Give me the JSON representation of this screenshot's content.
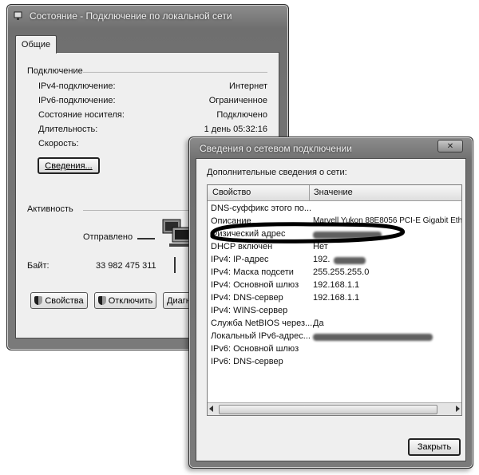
{
  "status_window": {
    "title": "Состояние - Подключение по локальной сети",
    "tab": "Общие",
    "connection_section": "Подключение",
    "rows": [
      {
        "label": "IPv4-подключение:",
        "value": "Интернет"
      },
      {
        "label": "IPv6-подключение:",
        "value": "Ограниченное"
      },
      {
        "label": "Состояние носителя:",
        "value": "Подключено"
      },
      {
        "label": "Длительность:",
        "value": "1 день 05:32:16"
      },
      {
        "label": "Скорость:",
        "value": ""
      }
    ],
    "details_button": "Сведения...",
    "activity_section": "Активность",
    "sent_label": "Отправлено",
    "bytes_label": "Байт:",
    "bytes_sent": "33 982 475 311",
    "buttons": {
      "properties": "Свойства",
      "disable": "Отключить",
      "diagnose": "Диагн"
    }
  },
  "details_window": {
    "title": "Сведения о сетевом подключении",
    "heading": "Дополнительные сведения о сети:",
    "columns": {
      "property": "Свойство",
      "value": "Значение"
    },
    "rows": [
      {
        "property": "DNS-суффикс этого по...",
        "value": ""
      },
      {
        "property": "Описание",
        "value": "Marvell Yukon 88E8056 PCI-E Gigabit Eth"
      },
      {
        "property": "Физический адрес",
        "value": ""
      },
      {
        "property": "DHCP включен",
        "value": "Нет"
      },
      {
        "property": "IPv4: IP-адрес",
        "value": "192."
      },
      {
        "property": "IPv4: Маска подсети",
        "value": "255.255.255.0"
      },
      {
        "property": "IPv4: Основной шлюз",
        "value": "192.168.1.1"
      },
      {
        "property": "IPv4: DNS-сервер",
        "value": "192.168.1.1"
      },
      {
        "property": "IPv4: WINS-сервер",
        "value": ""
      },
      {
        "property": "Служба NetBIOS через...",
        "value": "Да"
      },
      {
        "property": "Локальный IPv6-адрес...",
        "value": ""
      },
      {
        "property": "IPv6: Основной шлюз",
        "value": ""
      },
      {
        "property": "IPv6: DNS-сервер",
        "value": ""
      }
    ],
    "close_button": "Закрыть"
  },
  "colors": {
    "window_frame": "#7a7a7a",
    "client_bg": "#efefef",
    "highlight_ellipse": "#000000"
  },
  "icons": [
    "network-icon",
    "network-computers-icon",
    "shield-icon",
    "close-icon"
  ]
}
